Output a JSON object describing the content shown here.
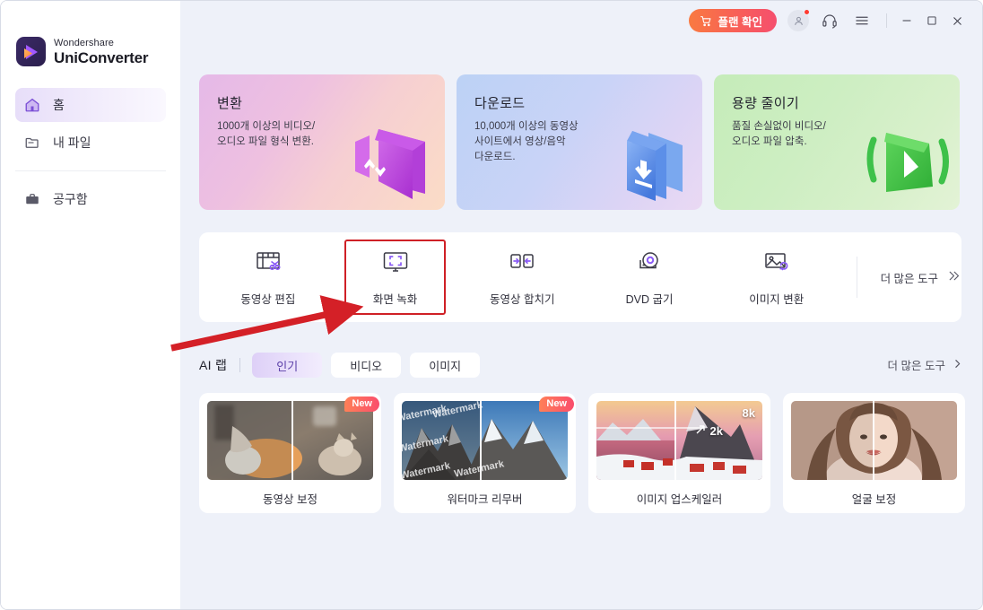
{
  "app": {
    "brand_top": "Wondershare",
    "brand_bottom": "UniConverter"
  },
  "titlebar": {
    "plan_button": "플랜 확인",
    "cart_icon": "cart-icon",
    "account_icon": "user-account-icon",
    "support_icon": "headset-support-icon",
    "menu_icon": "hamburger-menu-icon",
    "minimize_icon": "minimize-icon",
    "maximize_icon": "maximize-icon",
    "close_icon": "close-icon",
    "plan_gradient_from": "#f97a41",
    "plan_gradient_to": "#f54f6e"
  },
  "sidebar": {
    "items": [
      {
        "label": "홈",
        "icon": "home-icon",
        "active": true
      },
      {
        "label": "내 파일",
        "icon": "folder-icon",
        "active": false
      },
      {
        "label": "공구함",
        "icon": "toolbox-icon",
        "active": false
      }
    ]
  },
  "hero_cards": [
    {
      "title": "변환",
      "desc": "1000개 이상의 비디오/\n오디오 파일 형식 변환.",
      "art": "convert-art",
      "accent": "#c155d8"
    },
    {
      "title": "다운로드",
      "desc": "10,000개 이상의 동영상\n사이트에서 영상/음악\n다운로드.",
      "art": "download-art",
      "accent": "#4e86e8"
    },
    {
      "title": "용량 줄이기",
      "desc": "품질 손실없이 비디오/\n오디오 파일 압축.",
      "art": "compress-art",
      "accent": "#46c14a"
    }
  ],
  "tools": {
    "items": [
      {
        "label": "동영상 편집",
        "icon": "video-edit-icon",
        "highlighted": false
      },
      {
        "label": "화면 녹화",
        "icon": "screen-record-icon",
        "highlighted": true
      },
      {
        "label": "동영상 합치기",
        "icon": "video-merge-icon",
        "highlighted": false
      },
      {
        "label": "DVD 굽기",
        "icon": "dvd-burn-icon",
        "highlighted": false
      },
      {
        "label": "이미지 변환",
        "icon": "image-convert-icon",
        "highlighted": false
      }
    ],
    "more_label": "더 많은 도구",
    "more_icon": "double-chevron-right-icon",
    "highlight_color": "#cf2026"
  },
  "ailab": {
    "title": "AI 랩",
    "tabs": [
      {
        "label": "인기",
        "active": true
      },
      {
        "label": "비디오",
        "active": false
      },
      {
        "label": "이미지",
        "active": false
      }
    ],
    "more_label": "더 많은 도구",
    "more_icon": "chevron-right-icon"
  },
  "thumbnails": [
    {
      "caption": "동영상 보정",
      "badge": "New",
      "art": "cat-photo"
    },
    {
      "caption": "워터마크 리무버",
      "badge": "New",
      "art": "mountain-watermark-photo",
      "watermark_text": "Watermark"
    },
    {
      "caption": "이미지 업스케일러",
      "badge": "",
      "art": "village-photo",
      "labels": [
        "8k",
        "2k"
      ]
    },
    {
      "caption": "얼굴 보정",
      "badge": "",
      "art": "portrait-photo"
    }
  ],
  "annotation": {
    "arrow_color": "#d42027",
    "arrow_name": "red-pointer-arrow"
  }
}
